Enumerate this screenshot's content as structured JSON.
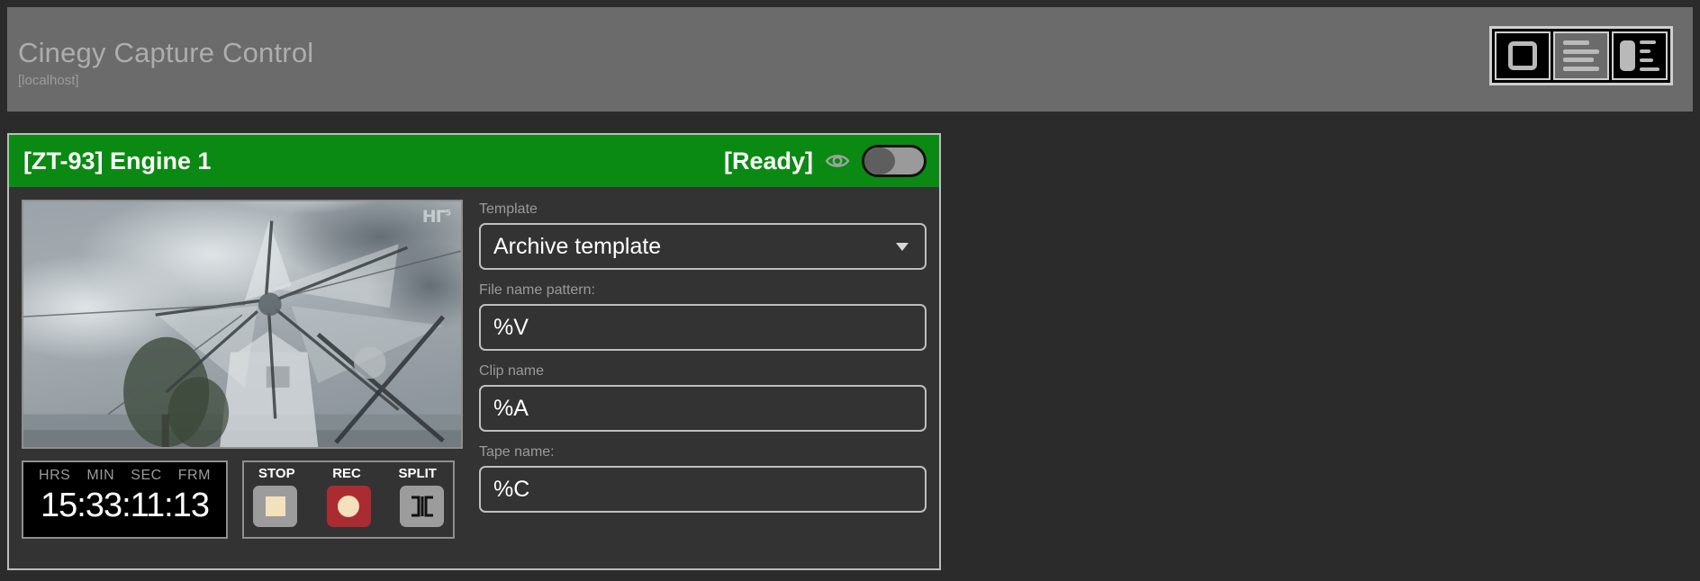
{
  "app": {
    "title": "Cinegy Capture Control",
    "host": "[localhost]",
    "view_modes": [
      {
        "name": "single-view",
        "label": "Single view"
      },
      {
        "name": "list-view",
        "label": "List view"
      },
      {
        "name": "split-view",
        "label": "Split view"
      }
    ],
    "selected_view_mode": 1
  },
  "engine": {
    "name": "[ZT-93] Engine 1",
    "state": "[Ready]",
    "preview_toggle_on": false,
    "eye_icon": "eye-icon",
    "watermark": "HГ",
    "watermark_sup": "5"
  },
  "timecode": {
    "labels": [
      "HRS",
      "MIN",
      "SEC",
      "FRM"
    ],
    "value": "15:33:11:13"
  },
  "transport": {
    "buttons": [
      {
        "label": "STOP",
        "icon": "stop-square-icon"
      },
      {
        "label": "REC",
        "icon": "record-circle-icon"
      },
      {
        "label": "SPLIT",
        "icon": "split-icon"
      }
    ]
  },
  "form": {
    "template": {
      "label": "Template",
      "value": "Archive template",
      "options": [
        "Archive template"
      ]
    },
    "file_name_pattern": {
      "label": "File name pattern:",
      "value": "%V",
      "placeholder": "%V"
    },
    "clip_name": {
      "label": "Clip name",
      "value": "%A",
      "placeholder": "%A"
    },
    "tape_name": {
      "label": "Tape name:",
      "value": "%C",
      "placeholder": "%C"
    }
  },
  "colors": {
    "page_bg": "#2b2b2b",
    "header_bg": "#6b6b6b",
    "engine_header_green": "#0a8a12",
    "panel_bg": "#333333",
    "rec_red": "#ab2b32",
    "button_grey": "#9c9c9c"
  }
}
